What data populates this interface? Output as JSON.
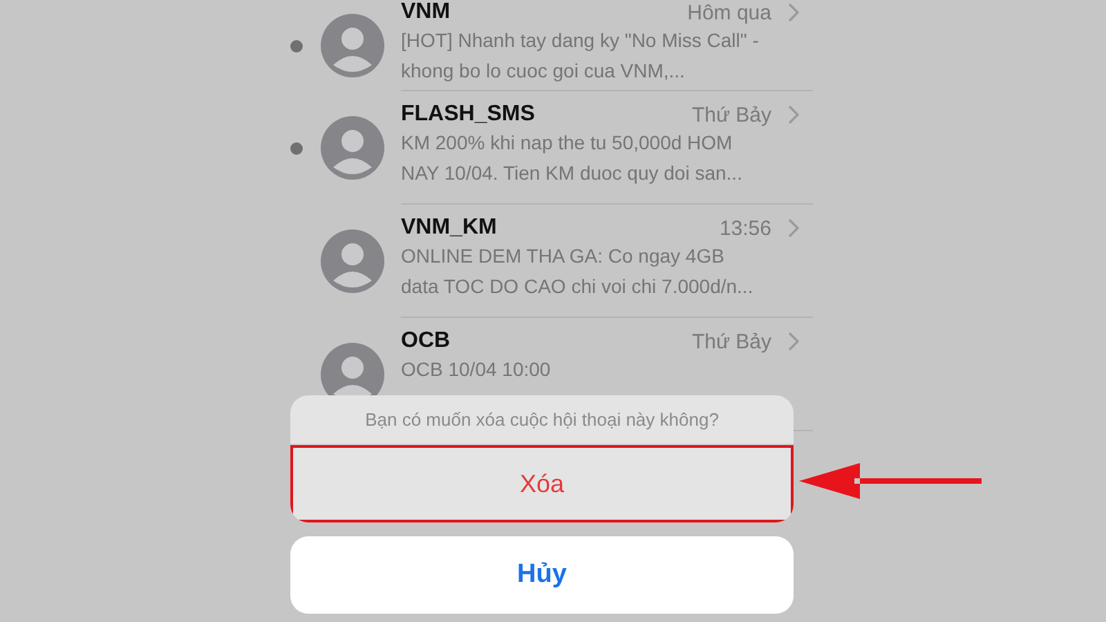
{
  "messages": [
    {
      "name": "VNM",
      "time": "Hôm qua",
      "unread": true,
      "preview": "[HOT] Nhanh tay dang ky \"No Miss Call\" - khong bo lo cuoc goi cua VNM,..."
    },
    {
      "name": "FLASH_SMS",
      "time": "Thứ Bảy",
      "unread": true,
      "preview": "KM 200% khi nap the tu 50,000d HOM NAY 10/04. Tien KM duoc quy doi san..."
    },
    {
      "name": "VNM_KM",
      "time": "13:56",
      "unread": false,
      "preview": "ONLINE DEM THA GA: Co ngay 4GB data TOC DO CAO chi voi chi 7.000d/n..."
    },
    {
      "name": "OCB",
      "time": "Thứ Bảy",
      "unread": false,
      "preview": "OCB 10/04 10:00"
    }
  ],
  "action_sheet": {
    "message": "Bạn có muốn xóa cuộc hội thoại này không?",
    "actions": [
      {
        "label": "Xóa",
        "kind": "destructive",
        "highlighted": true
      }
    ],
    "cancel": {
      "label": "Hủy"
    }
  }
}
